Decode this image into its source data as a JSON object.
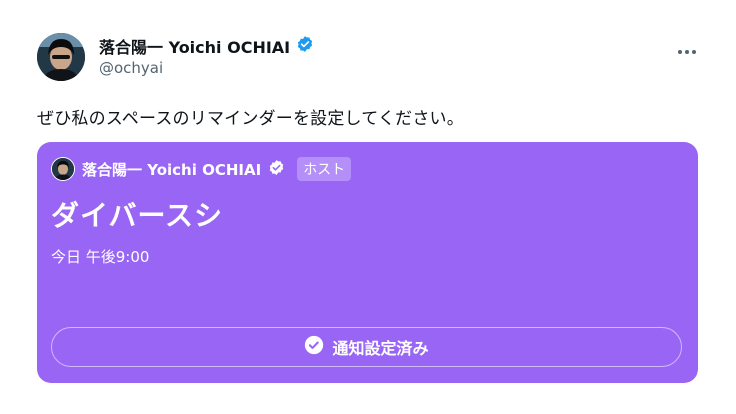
{
  "author": {
    "name": "落合陽一 Yoichi OCHIAI",
    "handle": "@ochyai",
    "verified_color": "#1d9bf0"
  },
  "tweet": {
    "text": "ぜひ私のスペースのリマインダーを設定してください。"
  },
  "space_card": {
    "background_color": "#9965f5",
    "host_name": "落合陽一 Yoichi OCHIAI",
    "host_badge": "ホスト",
    "title": "ダイバースシ",
    "scheduled_time": "今日 午後9:00",
    "reminder_button_label": "通知設定済み"
  },
  "icons": {
    "more": "more-horizontal-icon",
    "verified": "verified-badge-icon",
    "check": "check-circle-icon"
  }
}
